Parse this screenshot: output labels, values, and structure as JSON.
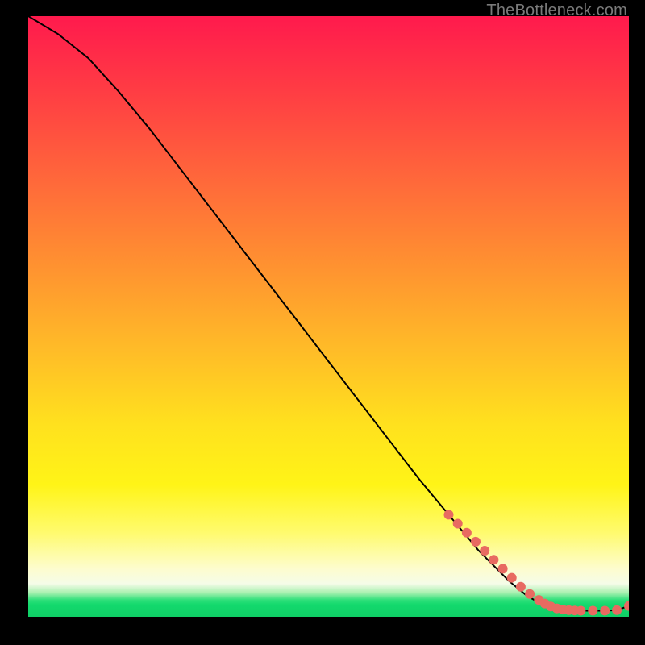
{
  "watermark": "TheBottleneck.com",
  "chart_data": {
    "type": "line",
    "title": "",
    "xlabel": "",
    "ylabel": "",
    "xlim": [
      0,
      100
    ],
    "ylim": [
      0,
      100
    ],
    "grid": false,
    "legend": false,
    "series": [
      {
        "name": "curve",
        "x": [
          0,
          5,
          10,
          15,
          20,
          25,
          30,
          35,
          40,
          45,
          50,
          55,
          60,
          65,
          70,
          75,
          80,
          83,
          86,
          88,
          90,
          92,
          94,
          96,
          98,
          100
        ],
        "y": [
          100,
          97,
          93,
          87.5,
          81.5,
          75,
          68.5,
          62,
          55.5,
          49,
          42.5,
          36,
          29.5,
          23,
          17,
          11,
          6,
          3.5,
          1.8,
          1.2,
          1.0,
          1.0,
          1.0,
          1.0,
          1.1,
          1.8
        ]
      },
      {
        "name": "highlight-dots",
        "x": [
          70,
          71.5,
          73,
          74.5,
          76,
          77.5,
          79,
          80.5,
          82,
          83.5,
          85,
          86,
          87,
          88,
          89,
          90,
          91,
          92,
          94,
          96,
          98,
          100
        ],
        "y": [
          17,
          15.5,
          14,
          12.5,
          11,
          9.5,
          8,
          6.5,
          5,
          3.8,
          2.8,
          2.2,
          1.7,
          1.4,
          1.2,
          1.1,
          1.05,
          1.0,
          1.0,
          1.0,
          1.1,
          1.8
        ]
      }
    ],
    "background_gradient": {
      "direction": "vertical",
      "stops": [
        {
          "pos": 0.0,
          "color": "#ff1a4d"
        },
        {
          "pos": 0.28,
          "color": "#ff6a3a"
        },
        {
          "pos": 0.55,
          "color": "#ffba28"
        },
        {
          "pos": 0.78,
          "color": "#fff417"
        },
        {
          "pos": 0.92,
          "color": "#fdfcce"
        },
        {
          "pos": 0.97,
          "color": "#2fe07a"
        },
        {
          "pos": 1.0,
          "color": "#0fcf66"
        }
      ]
    },
    "marker_color": "#e86a61",
    "line_color": "#000000"
  }
}
